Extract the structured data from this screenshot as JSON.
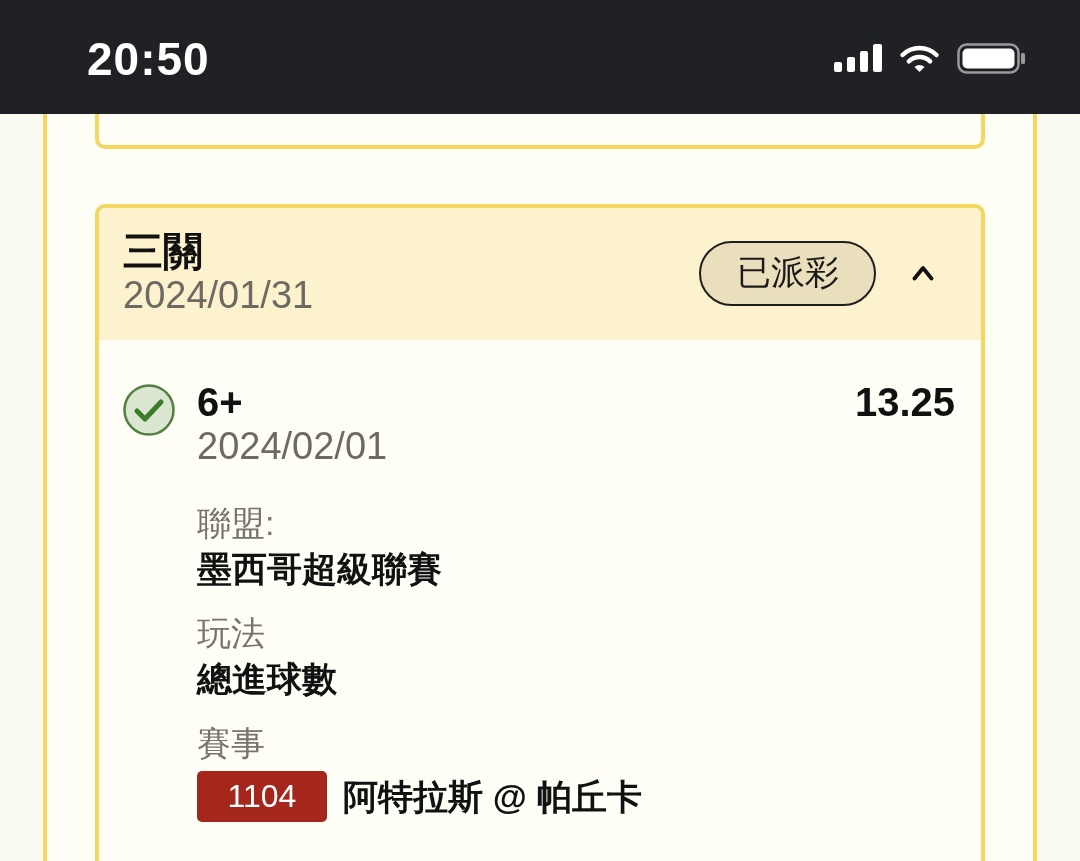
{
  "status_bar": {
    "time": "20:50"
  },
  "bet": {
    "type": "三關",
    "date": "2024/01/31",
    "status": "已派彩",
    "expanded": true,
    "legs": [
      {
        "selection": "6+",
        "date": "2024/02/01",
        "odds": "13.25",
        "won": true,
        "fields": [
          {
            "kind": "text",
            "label": "聯盟:",
            "value": "墨西哥超級聯賽"
          },
          {
            "kind": "text",
            "label": "玩法",
            "value": "總進球數"
          },
          {
            "kind": "match",
            "label": "賽事",
            "match_number": "1104",
            "value": "阿特拉斯 @ 帕丘卡"
          }
        ]
      }
    ]
  }
}
